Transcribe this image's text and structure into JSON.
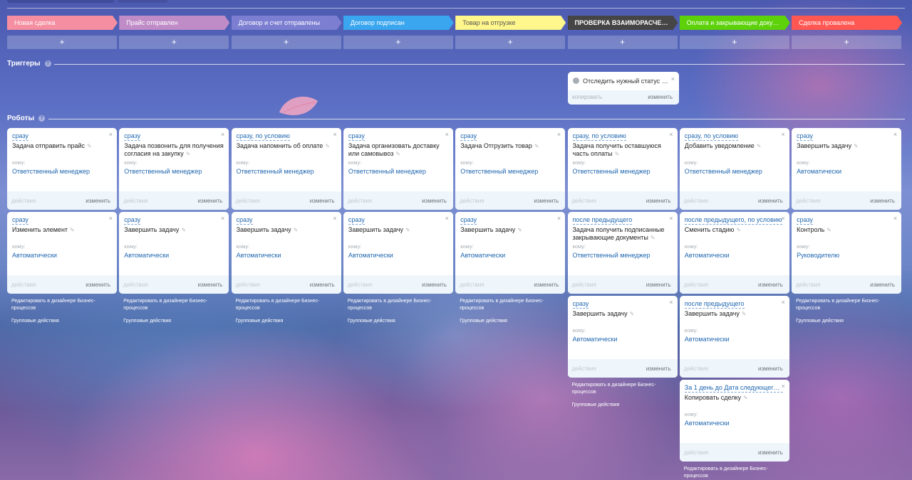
{
  "stages": [
    {
      "label": "Новая сделка",
      "bg": "#f58ea0",
      "fg": "#ffffff"
    },
    {
      "label": "Прайс отправлен",
      "bg": "#c08cc8",
      "fg": "#ffffff"
    },
    {
      "label": "Договор и счет отправлены",
      "bg": "#7c7ed1",
      "fg": "#ffffff"
    },
    {
      "label": "Договор подписан",
      "bg": "#39a6ef",
      "fg": "#ffffff"
    },
    {
      "label": "Товар на отгрузке",
      "bg": "#fff68c",
      "fg": "#555555"
    },
    {
      "label": "ПРОВЕРКА ВЗАИМОРАСЧЕТОВ",
      "bg": "#454545",
      "fg": "#ffffff"
    },
    {
      "label": "Оплата и закрывающие докуме...",
      "bg": "#5dd20b",
      "fg": "#ffffff"
    },
    {
      "label": "Сделка провалена",
      "bg": "#ff5752",
      "fg": "#ffffff"
    }
  ],
  "plus": "+",
  "triggers_title": "Триггеры",
  "robots_title": "Роботы",
  "help_glyph": "?",
  "trigger": {
    "text": "Отследить нужный статус за...",
    "copy": "копировать",
    "edit": "изменить",
    "close": "×"
  },
  "labels": {
    "to_whom": "кому:",
    "actions": "действия",
    "edit": "изменить",
    "close": "×",
    "pen": "✎",
    "bp_designer": "Редактировать в дизайнере Бизнес-процессов",
    "group_actions": "Групповые действия"
  },
  "columns": [
    {
      "robots": [
        {
          "cond": "сразу",
          "title": "Задача отправить прайс",
          "who": "Ответственный менеджер"
        },
        {
          "cond": "сразу",
          "title": "Изменить элемент",
          "who": "Автоматически"
        }
      ]
    },
    {
      "robots": [
        {
          "cond": "сразу",
          "title": "Задача позвонить для получения согласия на закупку",
          "who": "Ответственный менеджер"
        },
        {
          "cond": "сразу",
          "title": "Завершить задачу",
          "who": "Автоматически"
        }
      ]
    },
    {
      "robots": [
        {
          "cond": "сразу, по условию",
          "title": "Задача напомнить об оплате",
          "who": "Ответственный менеджер"
        },
        {
          "cond": "сразу",
          "title": "Завершить задачу",
          "who": "Автоматически"
        }
      ]
    },
    {
      "robots": [
        {
          "cond": "сразу",
          "title": "Задача организовать доставку или самовывоз",
          "who": "Ответственный менеджер"
        },
        {
          "cond": "сразу",
          "title": "Завершить задачу",
          "who": "Автоматически"
        }
      ]
    },
    {
      "robots": [
        {
          "cond": "сразу",
          "title": "Задача Отгрузить товар",
          "who": "Ответственный менеджер"
        },
        {
          "cond": "сразу",
          "title": "Завершить задачу",
          "who": "Автоматически"
        }
      ]
    },
    {
      "robots": [
        {
          "cond": "сразу, по условию",
          "title": "Задача получить оставшуюся часть оплаты",
          "who": "Ответственный менеджер"
        },
        {
          "cond": "после предыдущего",
          "title": "Задача получить подписанные закрывающие документы",
          "who": "Ответственный менеджер"
        },
        {
          "cond": "сразу",
          "title": "Завершить задачу",
          "who": "Автоматически"
        }
      ]
    },
    {
      "robots": [
        {
          "cond": "сразу, по условию",
          "title": "Добавить уведомление",
          "who": "Ответственный менеджер"
        },
        {
          "cond": "после предыдущего, по условию",
          "title": "Сменить стадию",
          "who": "Автоматически"
        },
        {
          "cond": "после предыдущего",
          "title": "Завершить задачу",
          "who": "Автоматически"
        },
        {
          "cond": "За 1 день до Дата следующего ...",
          "title": "Копировать сделку",
          "who": "Автоматически"
        }
      ]
    },
    {
      "robots": [
        {
          "cond": "сразу",
          "title": "Завершить задачу",
          "who": "Автоматически"
        },
        {
          "cond": "сразу",
          "title": "Контроль",
          "who": "Руководителю"
        }
      ]
    }
  ]
}
